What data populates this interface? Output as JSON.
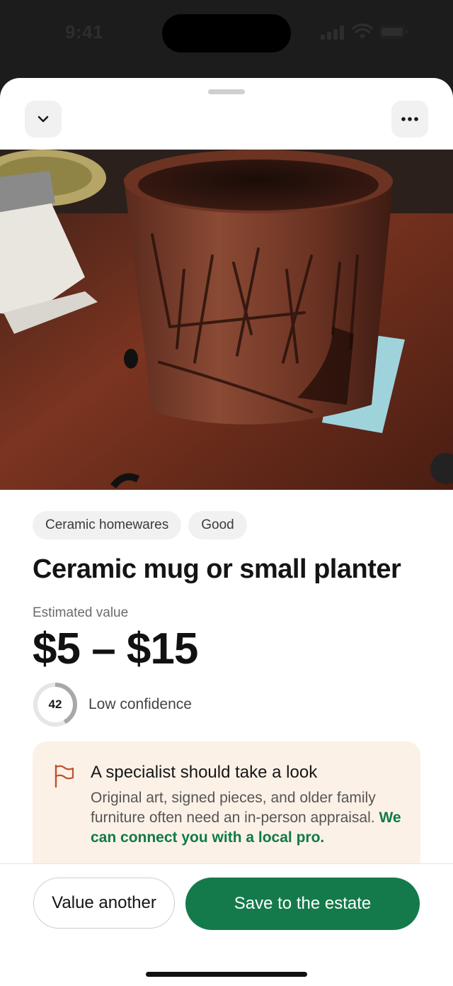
{
  "status_bar": {
    "time": "9:41"
  },
  "header": {
    "collapse_icon": "chevron-down-icon",
    "more_icon": "ellipsis-icon"
  },
  "photo": {
    "description_icon": "item-photo"
  },
  "item": {
    "tags": [
      "Ceramic homewares",
      "Good"
    ],
    "title": "Ceramic mug or small planter",
    "estimate_label": "Estimated value",
    "estimate_value": "$5 – $15",
    "confidence_score": "42",
    "confidence_fraction": 0.42,
    "confidence_label": "Low confidence"
  },
  "notice": {
    "icon": "flag-icon",
    "title": "A specialist should take a look",
    "body": "Original art, signed pieces, and older family furniture often need an in-person appraisal.",
    "link": "We can connect you with a local pro."
  },
  "actions": {
    "secondary": "Value another",
    "primary": "Save to the estate"
  },
  "colors": {
    "accent": "#157a4b",
    "link": "#0f7a45",
    "notice_bg": "#fcf1e7",
    "flag": "#c0502c"
  }
}
